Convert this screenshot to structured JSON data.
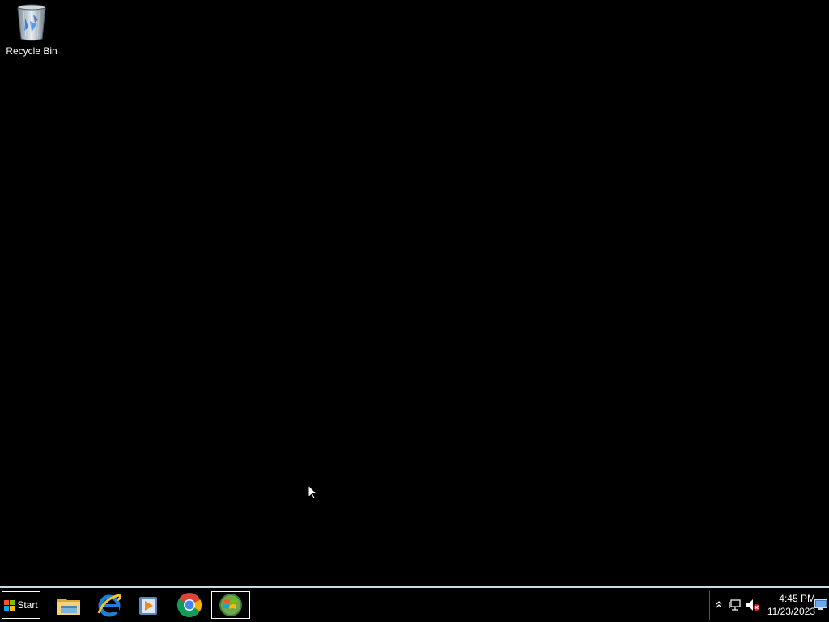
{
  "desktop": {
    "icons": [
      {
        "label": "Recycle Bin",
        "icon": "recycle-bin-icon"
      }
    ]
  },
  "taskbar": {
    "start_label": "Start",
    "pinned": [
      {
        "name": "file-explorer",
        "icon": "folder-icon"
      },
      {
        "name": "internet-explorer",
        "icon": "internet-explorer-icon"
      },
      {
        "name": "media-player",
        "icon": "media-player-icon"
      },
      {
        "name": "google-chrome",
        "icon": "chrome-icon"
      },
      {
        "name": "windows-app",
        "icon": "windows-logo-icon",
        "active": true
      }
    ],
    "tray": {
      "icons": [
        "show-hidden-icons-chevron",
        "network-icon",
        "volume-muted-icon",
        "show-desktop-icon"
      ],
      "time": "4:45 PM",
      "date": "11/23/2023"
    }
  },
  "colors": {
    "desktop_background": "#000000",
    "taskbar_border": "#c8dce8",
    "text": "#ffffff"
  }
}
